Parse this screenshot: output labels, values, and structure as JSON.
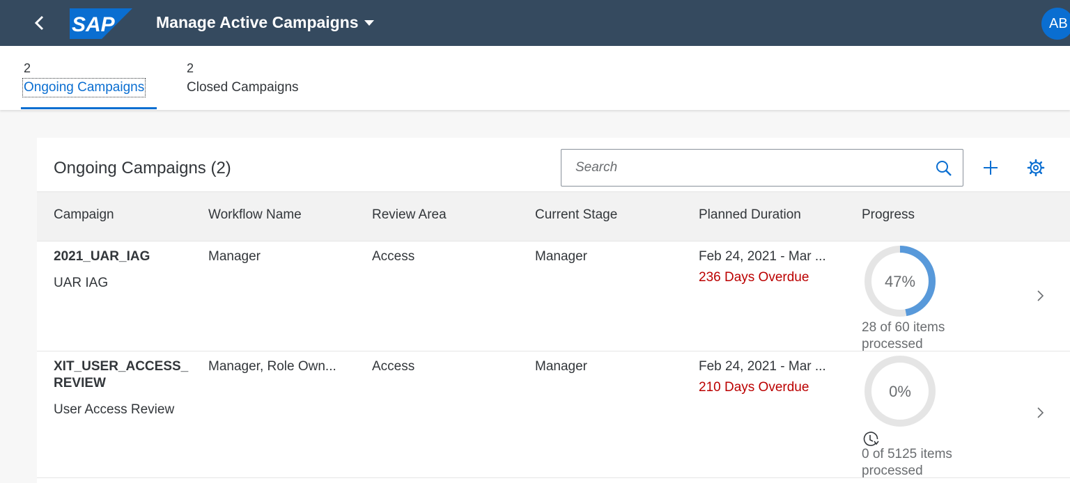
{
  "shell": {
    "title": "Manage Active Campaigns",
    "logo_text": "SAP",
    "avatar_initials": "AB",
    "icons": {
      "back": "chevron-left-icon",
      "title_menu": "caret-down-icon"
    },
    "colors": {
      "bar": "#354a5f",
      "avatar": "#0a6ed1",
      "logo": "#0a6ed1"
    }
  },
  "tabs": [
    {
      "count": "2",
      "label": "Ongoing Campaigns",
      "selected": true
    },
    {
      "count": "2",
      "label": "Closed Campaigns",
      "selected": false
    }
  ],
  "table": {
    "title": "Ongoing Campaigns (2)",
    "search_placeholder": "Search",
    "icons": {
      "search": "search-icon",
      "add": "add-icon",
      "settings": "gear-icon",
      "navigate": "chevron-right-icon",
      "pending": "clock-icon"
    },
    "columns": [
      "Campaign",
      "Workflow Name",
      "Review Area",
      "Current Stage",
      "Planned Duration",
      "Progress"
    ],
    "rows": [
      {
        "campaign_id": "2021_UAR_IAG",
        "campaign_desc": "UAR IAG",
        "workflow": "Manager",
        "review_area": "Access",
        "current_stage": "Manager",
        "planned_duration": "Feb 24, 2021 - Mar ...",
        "overdue": "236 Days Overdue",
        "progress_label": "47%",
        "progress_fraction": 0.47,
        "progress_text": "28 of 60 items processed"
      },
      {
        "campaign_id": "XIT_USER_ACCESS_REVIEW",
        "campaign_desc": "User Access Review",
        "workflow": "Manager, Role Own...",
        "review_area": "Access",
        "current_stage": "Manager",
        "planned_duration": "Feb 24, 2021 - Mar ...",
        "overdue": "210 Days Overdue",
        "progress_label": "0%",
        "progress_fraction": 0,
        "progress_text": "0 of 5125 items processed"
      }
    ],
    "colors": {
      "overdue": "#bb0000",
      "progress": "#5899da",
      "ring_track": "#e5e5e5",
      "link": "#0a6ed1"
    }
  }
}
